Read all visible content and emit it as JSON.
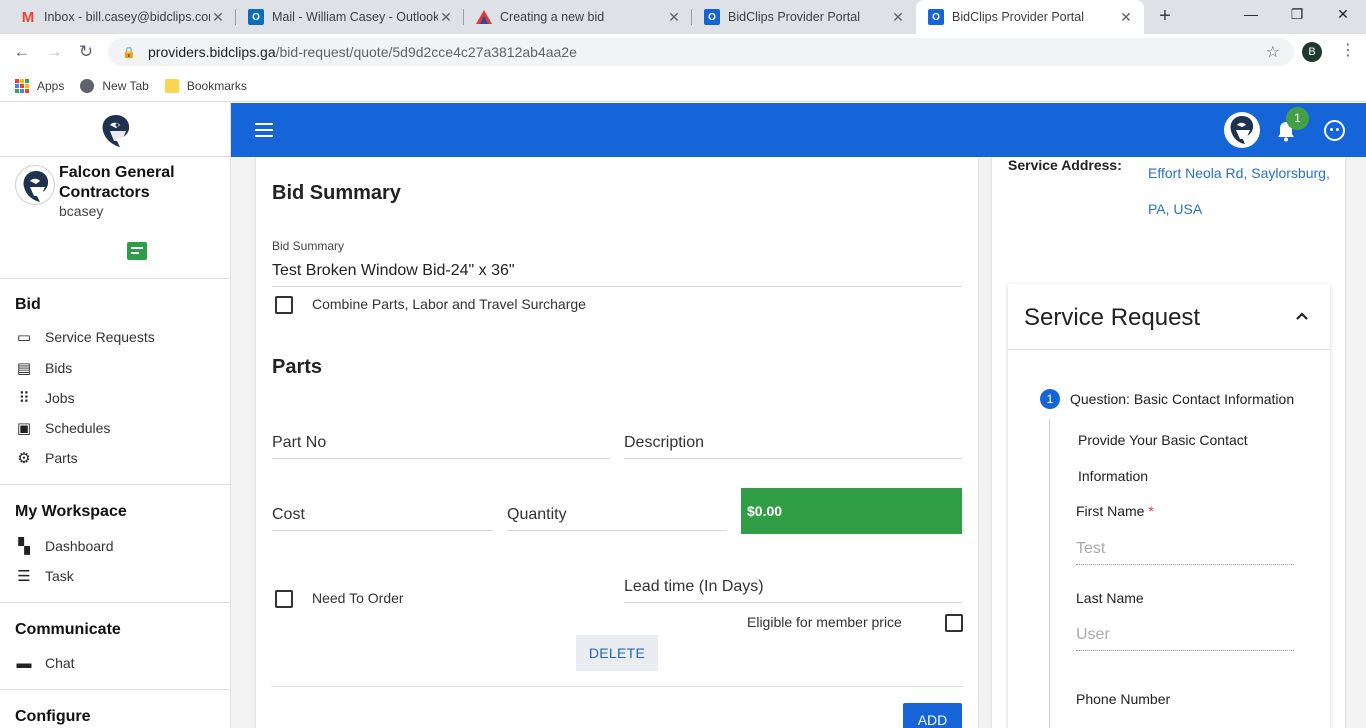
{
  "browser": {
    "tabs": [
      {
        "title": "Inbox - bill.casey@bidclips.com",
        "favicon_color": "#ea4335"
      },
      {
        "title": "Mail - William Casey - Outlook",
        "favicon_color": "#0f6cbd"
      },
      {
        "title": "Creating a new bid",
        "favicon_color": "#d93a3a"
      },
      {
        "title": "BidClips Provider Portal",
        "favicon_color": "#1565d8"
      },
      {
        "title": "BidClips Provider Portal",
        "favicon_color": "#1565d8"
      }
    ],
    "url_host": "providers.bidclips.ga",
    "url_path": "/bid-request/quote/5d9d2cce4c27a3812ab4aa2e",
    "profile_initial": "B",
    "bookmarks": [
      {
        "label": "Apps",
        "icon": "apps-grid-icon"
      },
      {
        "label": "New Tab",
        "icon": "globe-icon"
      },
      {
        "label": "Bookmarks",
        "icon": "folder-icon"
      }
    ]
  },
  "sidebar": {
    "company_name": "Falcon General Contractors",
    "username": "bcasey",
    "sections": [
      {
        "title": "Bid",
        "items": [
          {
            "label": "Service Requests",
            "icon": "service-requests-icon"
          },
          {
            "label": "Bids",
            "icon": "document-icon"
          },
          {
            "label": "Jobs",
            "icon": "grid-icon"
          },
          {
            "label": "Schedules",
            "icon": "contact-card-icon"
          },
          {
            "label": "Parts",
            "icon": "gear-icon"
          }
        ]
      },
      {
        "title": "My Workspace",
        "items": [
          {
            "label": "Dashboard",
            "icon": "dashboard-icon"
          },
          {
            "label": "Task",
            "icon": "list-icon"
          }
        ]
      },
      {
        "title": "Communicate",
        "items": [
          {
            "label": "Chat",
            "icon": "chat-icon"
          }
        ]
      },
      {
        "title": "Configure",
        "items": []
      }
    ]
  },
  "header": {
    "notification_count": "1",
    "accent_color": "#1565d8"
  },
  "bid": {
    "section_title": "Bid Summary",
    "summary_label": "Bid Summary",
    "summary_value": "Test Broken Window Bid-24\" x 36\"",
    "combine_label": "Combine Parts, Labor and Travel Surcharge",
    "parts_title": "Parts",
    "part_no_placeholder": "Part No",
    "description_placeholder": "Description",
    "cost_placeholder": "Cost",
    "quantity_placeholder": "Quantity",
    "line_total": "$0.00",
    "need_to_order_label": "Need To Order",
    "lead_time_placeholder": "Lead time (In Days)",
    "member_price_label": "Eligible for member price",
    "delete_label": "DELETE",
    "add_label": "ADD"
  },
  "service": {
    "address_label": "Service Address:",
    "address_value": "Effort Neola Rd, Saylorsburg, PA, USA",
    "request_title": "Service Request",
    "step_number": "1",
    "step_title": "Question: Basic Contact Information",
    "step_description": "Provide Your Basic Contact Information",
    "first_name_label": "First Name",
    "first_name_required": "*",
    "first_name_value": "Test",
    "last_name_label": "Last Name",
    "last_name_value": "User",
    "phone_label": "Phone Number"
  }
}
